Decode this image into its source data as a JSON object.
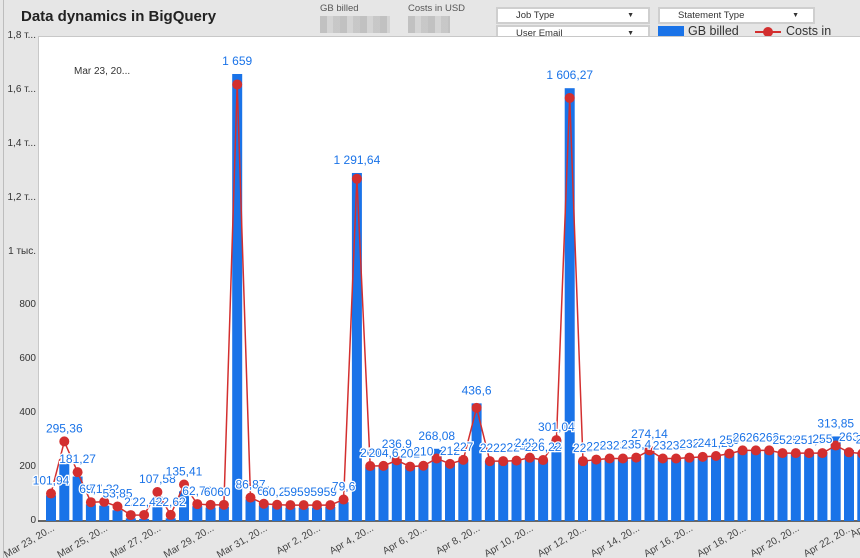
{
  "header": {
    "title": "Data dynamics in BigQuery"
  },
  "scorecards": [
    {
      "label": "GB billed"
    },
    {
      "label": "Costs in USD"
    }
  ],
  "filters": [
    {
      "label": "Job Type"
    },
    {
      "label": "Statement Type"
    },
    {
      "label": "User Email"
    }
  ],
  "colors": {
    "bars": "#1a73e8",
    "line": "#d32f2f",
    "labels": "#1a73e8"
  },
  "annotation": "Mar 23, 20...",
  "chart_data": {
    "type": "bar+line",
    "title": "Data dynamics in BigQuery",
    "legend": {
      "position": "top-right",
      "entries": [
        "GB billed",
        "Costs in USD"
      ]
    },
    "y_ticks": [
      {
        "value": 0,
        "label": "0"
      },
      {
        "value": 200,
        "label": "200"
      },
      {
        "value": 400,
        "label": "400"
      },
      {
        "value": 600,
        "label": "600"
      },
      {
        "value": 800,
        "label": "800"
      },
      {
        "value": 1000,
        "label": "1 тыс."
      },
      {
        "value": 1200,
        "label": "1,2 т..."
      },
      {
        "value": 1400,
        "label": "1,4 т..."
      },
      {
        "value": 1600,
        "label": "1,6 т..."
      },
      {
        "value": 1800,
        "label": "1,8 т..."
      }
    ],
    "ylim": [
      0,
      1800
    ],
    "x_ticks": [
      {
        "index": 0,
        "label": "Mar 23, 20..."
      },
      {
        "index": 4,
        "label": "Mar 25, 20..."
      },
      {
        "index": 8,
        "label": "Mar 27, 20..."
      },
      {
        "index": 12,
        "label": "Mar 29, 20..."
      },
      {
        "index": 16,
        "label": "Mar 31, 20..."
      },
      {
        "index": 20,
        "label": "Apr 2, 20..."
      },
      {
        "index": 24,
        "label": "Apr 4, 20..."
      },
      {
        "index": 28,
        "label": "Apr 6, 20..."
      },
      {
        "index": 32,
        "label": "Apr 8, 20..."
      },
      {
        "index": 36,
        "label": "Apr 10, 20..."
      },
      {
        "index": 40,
        "label": "Apr 12, 20..."
      },
      {
        "index": 44,
        "label": "Apr 14, 20..."
      },
      {
        "index": 48,
        "label": "Apr 16, 20..."
      },
      {
        "index": 52,
        "label": "Apr 18, 20..."
      },
      {
        "index": 56,
        "label": "Apr 20, 20..."
      },
      {
        "index": 60,
        "label": "Apr 22, 20..."
      },
      {
        "index": 61,
        "label": "Apr"
      }
    ],
    "series": [
      {
        "name": "GB billed",
        "type": "bar",
        "values": [
          95,
          220,
          165,
          62,
          57,
          40,
          10,
          8,
          90,
          10,
          110,
          55,
          50,
          52,
          1659,
          80,
          58,
          55,
          50,
          50,
          50,
          52,
          70,
          1291.64,
          200,
          204,
          236.9,
          202,
          210,
          268.08,
          212,
          227,
          436.6,
          222,
          222,
          224,
          240.6,
          226.22,
          301.04,
          1606.27,
          222,
          228,
          232,
          232,
          235.4,
          274.14,
          232,
          232,
          238,
          240,
          241.29,
          252,
          262,
          262,
          262,
          252,
          252,
          251.9,
          256,
          313.85,
          263,
          255
        ],
        "labels": [
          "101,94",
          "295,36",
          "181,27",
          "69,7",
          "71,32",
          "53,85",
          "22",
          "22,4",
          "107,58",
          "22,62",
          "135,41",
          "62,78",
          "60",
          "60",
          "1 659",
          "86,87",
          "64",
          "60,29",
          "59",
          "59",
          "59",
          "59",
          "79,6",
          "1 291,64",
          "204",
          "204,6",
          "236,9",
          "202",
          "210",
          "268,08",
          "212",
          "227",
          "436,6",
          "222",
          "222",
          "224",
          "240,6",
          "226,22",
          "301,04",
          "1 606,27",
          "222",
          "228",
          "232",
          "232",
          "235,4",
          "274,14",
          "232",
          "232",
          "238",
          "240",
          "241,29",
          "250",
          "262",
          "262",
          "262",
          "252",
          "252",
          "251,9",
          "255",
          "313,85",
          "263",
          "25"
        ]
      },
      {
        "name": "Costs in USD",
        "type": "line",
        "values": [
          101.94,
          295.36,
          181.27,
          69.7,
          71.32,
          53.85,
          22,
          22.4,
          107.58,
          22.62,
          135.41,
          62.78,
          60,
          60,
          1620,
          86.87,
          64,
          60.29,
          59,
          59,
          59,
          59,
          79.6,
          1270,
          204,
          204.6,
          225,
          202,
          205,
          232,
          212,
          227,
          420,
          222,
          222,
          224,
          235,
          226.22,
          300,
          1570,
          222,
          228,
          232,
          232,
          235.4,
          262,
          232,
          232,
          235,
          238,
          241.29,
          250,
          262,
          262,
          262,
          252,
          252,
          251.9,
          252,
          280,
          255,
          250
        ]
      }
    ]
  }
}
